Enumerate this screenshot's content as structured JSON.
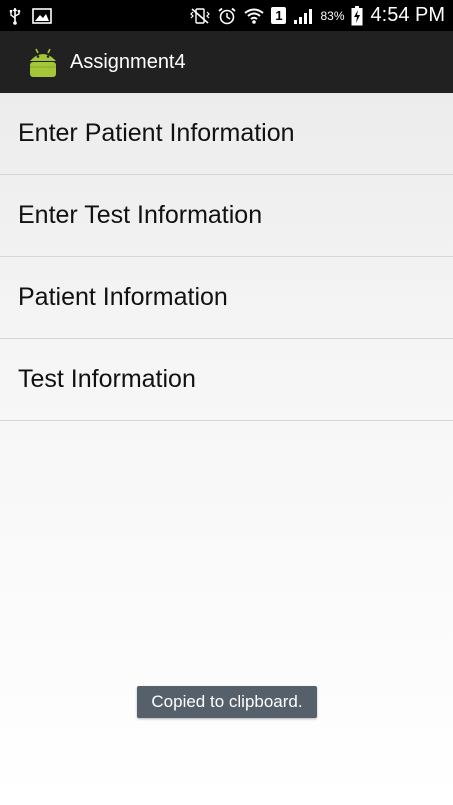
{
  "status_bar": {
    "left_icons": [
      "usb-icon",
      "image-icon"
    ],
    "right_icons": [
      "vibrate-icon",
      "alarm-icon",
      "wifi-icon",
      "signal-icon",
      "battery-icon"
    ],
    "sim_label": "1",
    "battery_percent": "83%",
    "time": "4:54 PM"
  },
  "action_bar": {
    "title": "Assignment4",
    "icon": "android-icon"
  },
  "menu": {
    "items": [
      {
        "label": "Enter Patient Information"
      },
      {
        "label": "Enter Test Information"
      },
      {
        "label": "Patient Information"
      },
      {
        "label": "Test Information"
      }
    ]
  },
  "toast": {
    "message": "Copied to clipboard."
  },
  "colors": {
    "status_bar_bg": "#000000",
    "action_bar_bg": "#212121",
    "toast_bg": "#55606a",
    "android_green": "#a4c639"
  }
}
